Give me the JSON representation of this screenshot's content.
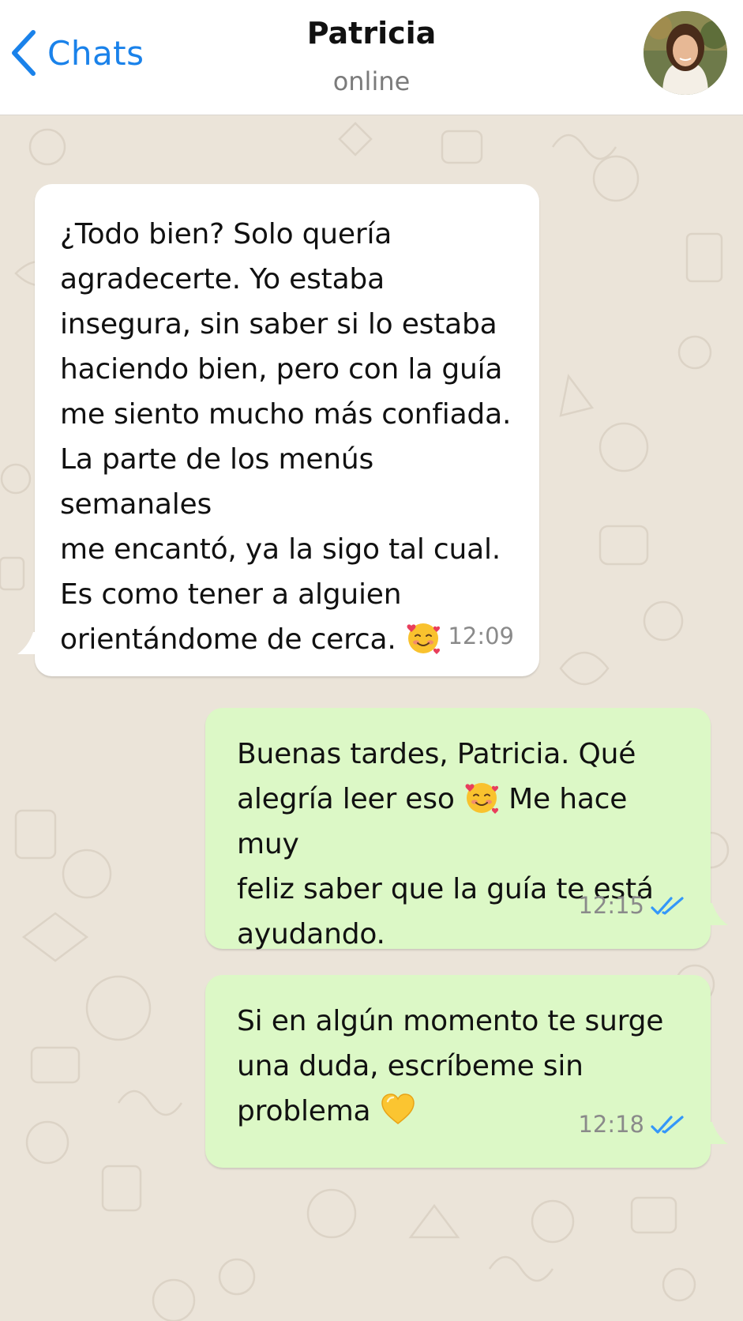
{
  "header": {
    "back_label": "Chats",
    "contact_name": "Patricia",
    "contact_status": "online"
  },
  "messages": [
    {
      "direction": "incoming",
      "text_lines": [
        "¿Todo bien? Solo quería",
        "agradecerte. Yo estaba",
        "insegura, sin saber si lo estaba",
        "haciendo bien, pero con la guía",
        "me siento mucho más confiada.",
        "La parte de los menús semanales",
        "me encantó, ya la sigo tal cual.",
        "Es como tener a alguien",
        "orientándome de cerca."
      ],
      "emoji": "smiling-face-with-hearts",
      "time": "12:09"
    },
    {
      "direction": "outgoing",
      "text_lines": [
        "Buenas tardes, Patricia. Qué",
        "alegría leer eso",
        "Me hace muy",
        "feliz saber que la guía te está",
        "ayudando."
      ],
      "emoji": "smiling-face-with-hearts",
      "time": "12:15",
      "status": "read"
    },
    {
      "direction": "outgoing",
      "text_lines": [
        "Si en algún momento te surge",
        "una duda, escríbeme sin",
        "problema"
      ],
      "emoji": "yellow-heart",
      "time": "12:18",
      "status": "read"
    }
  ],
  "colors": {
    "accent": "#1a82ea",
    "background": "#ebe4d9",
    "incoming_bubble": "#ffffff",
    "outgoing_bubble": "#dcf8c6",
    "read_tick": "#3497f9"
  }
}
